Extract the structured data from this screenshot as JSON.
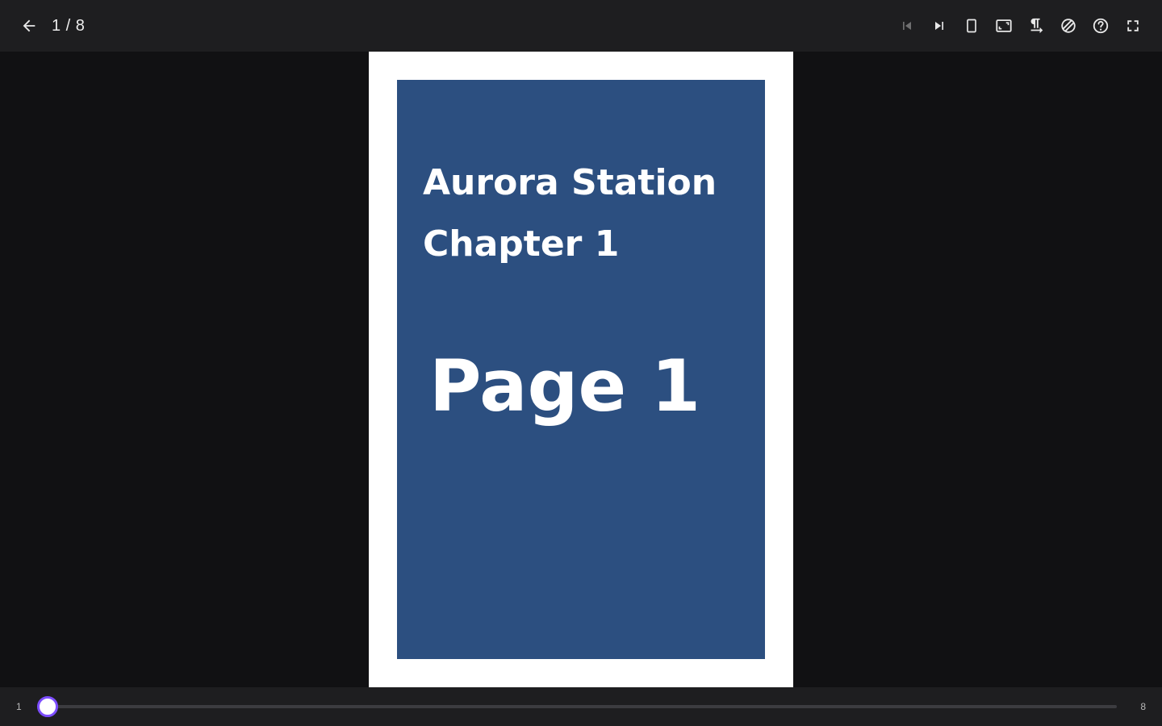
{
  "header": {
    "back_icon": "arrow-left-icon",
    "page_indicator": "1 / 8"
  },
  "toolbar": {
    "buttons": [
      {
        "id": "first-page",
        "icon": "skip-previous-icon",
        "disabled": true
      },
      {
        "id": "next-page",
        "icon": "skip-next-icon",
        "disabled": false
      },
      {
        "id": "single-page",
        "icon": "single-page-layout-icon",
        "disabled": false
      },
      {
        "id": "fit-mode",
        "icon": "fit-screen-icon",
        "disabled": false
      },
      {
        "id": "reading-direction",
        "icon": "text-direction-icon",
        "disabled": false
      },
      {
        "id": "color-filter",
        "icon": "color-filter-icon",
        "disabled": false
      },
      {
        "id": "help",
        "icon": "help-circle-icon",
        "disabled": false
      },
      {
        "id": "fullscreen",
        "icon": "fullscreen-icon",
        "disabled": false
      }
    ]
  },
  "page": {
    "title_line1": "Aurora Station",
    "title_line2": "Chapter 1",
    "page_label": "Page 1",
    "background_color": "#2c4f80"
  },
  "slider": {
    "min_label": "1",
    "max_label": "8",
    "min": 1,
    "max": 8,
    "value": 1,
    "accent_color": "#7c4dff"
  }
}
